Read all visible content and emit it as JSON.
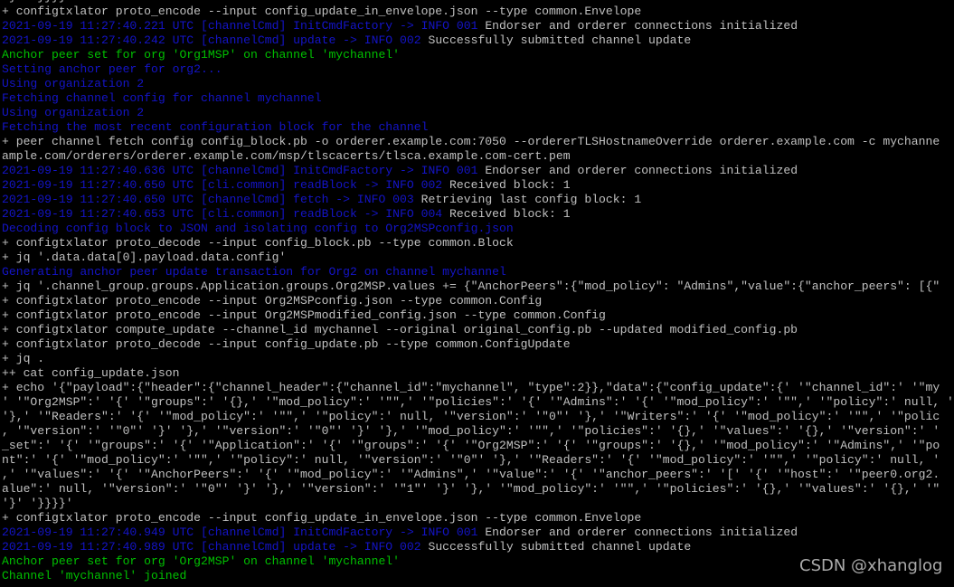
{
  "colors": {
    "gray": "#c0c0c0",
    "blue": "#1414c8",
    "green": "#00c000",
    "background": "#000000"
  },
  "terminal": {
    "lines": [
      [
        {
          "t": "'}' '}}}}'",
          "c": "gray"
        }
      ],
      [
        {
          "t": "+ configtxlator proto_encode --input config_update_in_envelope.json --type common.Envelope",
          "c": "gray"
        }
      ],
      [
        {
          "t": "2021-09-19 11:27:40.221 UTC [channelCmd] InitCmdFactory -> INFO 001",
          "c": "blue"
        },
        {
          "t": " Endorser and orderer connections initialized",
          "c": "gray"
        }
      ],
      [
        {
          "t": "2021-09-19 11:27:40.242 UTC [channelCmd] update -> INFO 002",
          "c": "blue"
        },
        {
          "t": " Successfully submitted channel update",
          "c": "gray"
        }
      ],
      [
        {
          "t": "Anchor peer set for org 'Org1MSP' on channel 'mychannel'",
          "c": "green"
        }
      ],
      [
        {
          "t": "Setting anchor peer for org2...",
          "c": "blue"
        }
      ],
      [
        {
          "t": "Using organization 2",
          "c": "blue"
        }
      ],
      [
        {
          "t": "Fetching channel config for channel mychannel",
          "c": "blue"
        }
      ],
      [
        {
          "t": "Using organization 2",
          "c": "blue"
        }
      ],
      [
        {
          "t": "Fetching the most recent configuration block for the channel",
          "c": "blue"
        }
      ],
      [
        {
          "t": "+ peer channel fetch config config_block.pb -o orderer.example.com:7050 --ordererTLSHostnameOverride orderer.example.com -c mychanne",
          "c": "gray"
        }
      ],
      [
        {
          "t": "ample.com/orderers/orderer.example.com/msp/tlscacerts/tlsca.example.com-cert.pem",
          "c": "gray"
        }
      ],
      [
        {
          "t": "2021-09-19 11:27:40.636 UTC [channelCmd] InitCmdFactory -> INFO 001",
          "c": "blue"
        },
        {
          "t": " Endorser and orderer connections initialized",
          "c": "gray"
        }
      ],
      [
        {
          "t": "2021-09-19 11:27:40.650 UTC [cli.common] readBlock -> INFO 002",
          "c": "blue"
        },
        {
          "t": " Received block: 1",
          "c": "gray"
        }
      ],
      [
        {
          "t": "2021-09-19 11:27:40.650 UTC [channelCmd] fetch -> INFO 003",
          "c": "blue"
        },
        {
          "t": " Retrieving last config block: 1",
          "c": "gray"
        }
      ],
      [
        {
          "t": "2021-09-19 11:27:40.653 UTC [cli.common] readBlock -> INFO 004",
          "c": "blue"
        },
        {
          "t": " Received block: 1",
          "c": "gray"
        }
      ],
      [
        {
          "t": "Decoding config block to JSON and isolating config to Org2MSPconfig.json",
          "c": "blue"
        }
      ],
      [
        {
          "t": "+ configtxlator proto_decode --input config_block.pb --type common.Block",
          "c": "gray"
        }
      ],
      [
        {
          "t": "+ jq '.data.data[0].payload.data.config'",
          "c": "gray"
        }
      ],
      [
        {
          "t": "Generating anchor peer update transaction for Org2 on channel mychannel",
          "c": "blue"
        }
      ],
      [
        {
          "t": "+ jq '.channel_group.groups.Application.groups.Org2MSP.values += {\"AnchorPeers\":{\"mod_policy\": \"Admins\",\"value\":{\"anchor_peers\": [{\"",
          "c": "gray"
        }
      ],
      [
        {
          "t": "+ configtxlator proto_encode --input Org2MSPconfig.json --type common.Config",
          "c": "gray"
        }
      ],
      [
        {
          "t": "+ configtxlator proto_encode --input Org2MSPmodified_config.json --type common.Config",
          "c": "gray"
        }
      ],
      [
        {
          "t": "+ configtxlator compute_update --channel_id mychannel --original original_config.pb --updated modified_config.pb",
          "c": "gray"
        }
      ],
      [
        {
          "t": "+ configtxlator proto_decode --input config_update.pb --type common.ConfigUpdate",
          "c": "gray"
        }
      ],
      [
        {
          "t": "+ jq .",
          "c": "gray"
        }
      ],
      [
        {
          "t": "++ cat config_update.json",
          "c": "gray"
        }
      ],
      [
        {
          "t": "+ echo '{\"payload\":{\"header\":{\"channel_header\":{\"channel_id\":\"mychannel\", \"type\":2}},\"data\":{\"config_update\":{' '\"channel_id\":' '\"my",
          "c": "gray"
        }
      ],
      [
        {
          "t": "' '\"Org2MSP\":' '{' '\"groups\":' '{},' '\"mod_policy\":' '\"\",' '\"policies\":' '{' '\"Admins\":' '{' '\"mod_policy\":' '\"\",' '\"policy\":' null, '",
          "c": "gray"
        }
      ],
      [
        {
          "t": "'},' '\"Readers\":' '{' '\"mod_policy\":' '\"\",' '\"policy\":' null, '\"version\":' '\"0\"' '},' '\"Writers\":' '{' '\"mod_policy\":' '\"\",' '\"polic",
          "c": "gray"
        }
      ],
      [
        {
          "t": ", '\"version\":' '\"0\"' '}' '},' '\"version\":' '\"0\"' '}' '},' '\"mod_policy\":' '\"\",' '\"policies\":' '{},' '\"values\":' '{},' '\"version\":' '",
          "c": "gray"
        }
      ],
      [
        {
          "t": "_set\":' '{' '\"groups\":' '{' '\"Application\":' '{' '\"groups\":' '{' '\"Org2MSP\":' '{' '\"groups\":' '{},' '\"mod_policy\":' '\"Admins\",' '\"po",
          "c": "gray"
        }
      ],
      [
        {
          "t": "nt\":' '{' '\"mod_policy\":' '\"\",' '\"policy\":' null, '\"version\":' '\"0\"' '},' '\"Readers\":' '{' '\"mod_policy\":' '\"\",' '\"policy\":' null, '",
          "c": "gray"
        }
      ],
      [
        {
          "t": ",' '\"values\":' '{' '\"AnchorPeers\":' '{' '\"mod_policy\":' '\"Admins\",' '\"value\":' '{' '\"anchor_peers\":' '[' '{' '\"host\":' '\"peer0.org2.",
          "c": "gray"
        }
      ],
      [
        {
          "t": "alue\":' null, '\"version\":' '\"0\"' '}' '},' '\"version\":' '\"1\"' '}' '},' '\"mod_policy\":' '\"\",' '\"policies\":' '{},' '\"values\":' '{},' '\"",
          "c": "gray"
        }
      ],
      [
        {
          "t": "'}' '}}}}'",
          "c": "gray"
        }
      ],
      [
        {
          "t": "+ configtxlator proto_encode --input config_update_in_envelope.json --type common.Envelope",
          "c": "gray"
        }
      ],
      [
        {
          "t": "2021-09-19 11:27:40.949 UTC [channelCmd] InitCmdFactory -> INFO 001",
          "c": "blue"
        },
        {
          "t": " Endorser and orderer connections initialized",
          "c": "gray"
        }
      ],
      [
        {
          "t": "2021-09-19 11:27:40.989 UTC [channelCmd] update -> INFO 002",
          "c": "blue"
        },
        {
          "t": " Successfully submitted channel update",
          "c": "gray"
        }
      ],
      [
        {
          "t": "Anchor peer set for org 'Org2MSP' on channel 'mychannel'",
          "c": "green"
        }
      ],
      [
        {
          "t": "Channel 'mychannel' joined",
          "c": "green"
        }
      ]
    ]
  },
  "watermark": "CSDN @xhanglog"
}
